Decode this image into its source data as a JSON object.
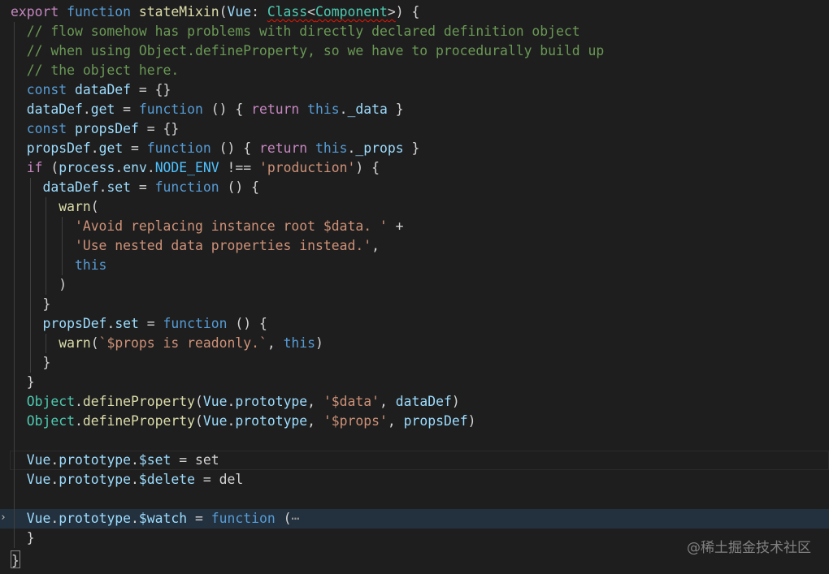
{
  "colors": {
    "keyword": "#c586c0",
    "storage": "#569cd6",
    "function": "#dcdcaa",
    "variable": "#9cdcfe",
    "type": "#4ec9b0",
    "string": "#ce9178",
    "comment": "#6a9955",
    "plain": "#d4d4d4",
    "constant": "#4fc1ff"
  },
  "lines": [
    {
      "indent": 0,
      "tokens": [
        [
          "export ",
          "keyword"
        ],
        [
          "function ",
          "storage"
        ],
        [
          "stateMixin",
          "function"
        ],
        [
          "(",
          "plain"
        ],
        [
          "Vue",
          "variable"
        ],
        [
          ": ",
          "plain"
        ],
        [
          "Class",
          "type",
          "squiggle"
        ],
        [
          "<",
          "plain",
          "squiggle"
        ],
        [
          "Component",
          "type",
          "squiggle"
        ],
        [
          ">",
          "plain",
          "squiggle"
        ],
        [
          ") {",
          "plain"
        ]
      ]
    },
    {
      "indent": 1,
      "tokens": [
        [
          "// flow somehow has problems with directly declared definition object",
          "comment"
        ]
      ]
    },
    {
      "indent": 1,
      "tokens": [
        [
          "// when using Object.defineProperty, so we have to procedurally build up",
          "comment"
        ]
      ]
    },
    {
      "indent": 1,
      "tokens": [
        [
          "// the object here.",
          "comment"
        ]
      ]
    },
    {
      "indent": 1,
      "tokens": [
        [
          "const ",
          "storage"
        ],
        [
          "dataDef",
          "variable"
        ],
        [
          " = {}",
          "plain"
        ]
      ]
    },
    {
      "indent": 1,
      "tokens": [
        [
          "dataDef",
          "variable"
        ],
        [
          ".",
          "plain"
        ],
        [
          "get",
          "variable"
        ],
        [
          " = ",
          "plain"
        ],
        [
          "function",
          "storage"
        ],
        [
          " () { ",
          "plain"
        ],
        [
          "return ",
          "keyword"
        ],
        [
          "this",
          "storage"
        ],
        [
          ".",
          "plain"
        ],
        [
          "_data",
          "variable"
        ],
        [
          " }",
          "plain"
        ]
      ]
    },
    {
      "indent": 1,
      "tokens": [
        [
          "const ",
          "storage"
        ],
        [
          "propsDef",
          "variable"
        ],
        [
          " = {}",
          "plain"
        ]
      ]
    },
    {
      "indent": 1,
      "tokens": [
        [
          "propsDef",
          "variable"
        ],
        [
          ".",
          "plain"
        ],
        [
          "get",
          "variable"
        ],
        [
          " = ",
          "plain"
        ],
        [
          "function",
          "storage"
        ],
        [
          " () { ",
          "plain"
        ],
        [
          "return ",
          "keyword"
        ],
        [
          "this",
          "storage"
        ],
        [
          ".",
          "plain"
        ],
        [
          "_props",
          "variable"
        ],
        [
          " }",
          "plain"
        ]
      ]
    },
    {
      "indent": 1,
      "tokens": [
        [
          "if",
          "keyword"
        ],
        [
          " (",
          "plain"
        ],
        [
          "process",
          "variable"
        ],
        [
          ".",
          "plain"
        ],
        [
          "env",
          "variable"
        ],
        [
          ".",
          "plain"
        ],
        [
          "NODE_ENV",
          "constant"
        ],
        [
          " !== ",
          "plain"
        ],
        [
          "'production'",
          "string"
        ],
        [
          ") {",
          "plain"
        ]
      ]
    },
    {
      "indent": 2,
      "tokens": [
        [
          "dataDef",
          "variable"
        ],
        [
          ".",
          "plain"
        ],
        [
          "set",
          "variable"
        ],
        [
          " = ",
          "plain"
        ],
        [
          "function",
          "storage"
        ],
        [
          " () {",
          "plain"
        ]
      ]
    },
    {
      "indent": 3,
      "tokens": [
        [
          "warn",
          "function"
        ],
        [
          "(",
          "plain"
        ]
      ]
    },
    {
      "indent": 4,
      "tokens": [
        [
          "'Avoid replacing instance root $data. '",
          "string"
        ],
        [
          " +",
          "plain"
        ]
      ]
    },
    {
      "indent": 4,
      "tokens": [
        [
          "'Use nested data properties instead.'",
          "string"
        ],
        [
          ",",
          "plain"
        ]
      ]
    },
    {
      "indent": 4,
      "tokens": [
        [
          "this",
          "storage"
        ]
      ]
    },
    {
      "indent": 3,
      "tokens": [
        [
          ")",
          "plain"
        ]
      ]
    },
    {
      "indent": 2,
      "tokens": [
        [
          "}",
          "plain"
        ]
      ]
    },
    {
      "indent": 2,
      "tokens": [
        [
          "propsDef",
          "variable"
        ],
        [
          ".",
          "plain"
        ],
        [
          "set",
          "variable"
        ],
        [
          " = ",
          "plain"
        ],
        [
          "function",
          "storage"
        ],
        [
          " () {",
          "plain"
        ]
      ]
    },
    {
      "indent": 3,
      "tokens": [
        [
          "warn",
          "function"
        ],
        [
          "(",
          "plain"
        ],
        [
          "`$props is readonly.`",
          "string"
        ],
        [
          ", ",
          "plain"
        ],
        [
          "this",
          "storage"
        ],
        [
          ")",
          "plain"
        ]
      ]
    },
    {
      "indent": 2,
      "tokens": [
        [
          "}",
          "plain"
        ]
      ]
    },
    {
      "indent": 1,
      "tokens": [
        [
          "}",
          "plain"
        ]
      ]
    },
    {
      "indent": 1,
      "tokens": [
        [
          "Object",
          "type"
        ],
        [
          ".",
          "plain"
        ],
        [
          "defineProperty",
          "function"
        ],
        [
          "(",
          "plain"
        ],
        [
          "Vue",
          "variable"
        ],
        [
          ".",
          "plain"
        ],
        [
          "prototype",
          "variable"
        ],
        [
          ", ",
          "plain"
        ],
        [
          "'$data'",
          "string"
        ],
        [
          ", ",
          "plain"
        ],
        [
          "dataDef",
          "variable"
        ],
        [
          ")",
          "plain"
        ]
      ]
    },
    {
      "indent": 1,
      "tokens": [
        [
          "Object",
          "type"
        ],
        [
          ".",
          "plain"
        ],
        [
          "defineProperty",
          "function"
        ],
        [
          "(",
          "plain"
        ],
        [
          "Vue",
          "variable"
        ],
        [
          ".",
          "plain"
        ],
        [
          "prototype",
          "variable"
        ],
        [
          ", ",
          "plain"
        ],
        [
          "'$props'",
          "string"
        ],
        [
          ", ",
          "plain"
        ],
        [
          "propsDef",
          "variable"
        ],
        [
          ")",
          "plain"
        ]
      ]
    },
    {
      "indent": 0,
      "guides": 1,
      "tokens": []
    },
    {
      "indent": 1,
      "current": true,
      "tokens": [
        [
          "Vue",
          "variable"
        ],
        [
          ".",
          "plain"
        ],
        [
          "prototype",
          "variable"
        ],
        [
          ".",
          "plain"
        ],
        [
          "$set",
          "variable"
        ],
        [
          " = ",
          "plain"
        ],
        [
          "set",
          "plain"
        ]
      ]
    },
    {
      "indent": 1,
      "tokens": [
        [
          "Vue",
          "variable"
        ],
        [
          ".",
          "plain"
        ],
        [
          "prototype",
          "variable"
        ],
        [
          ".",
          "plain"
        ],
        [
          "$delete",
          "variable"
        ],
        [
          " = ",
          "plain"
        ],
        [
          "del",
          "plain"
        ]
      ]
    },
    {
      "indent": 0,
      "guides": 1,
      "tokens": []
    },
    {
      "indent": 1,
      "folded": true,
      "tokens": [
        [
          "Vue",
          "variable"
        ],
        [
          ".",
          "plain"
        ],
        [
          "prototype",
          "variable"
        ],
        [
          ".",
          "plain"
        ],
        [
          "$watch",
          "variable"
        ],
        [
          " = ",
          "plain"
        ],
        [
          "function",
          "storage"
        ],
        [
          " (",
          "plain"
        ],
        [
          "⋯",
          "ellipsis"
        ]
      ]
    },
    {
      "indent": 1,
      "tokens": [
        [
          "}",
          "plain"
        ]
      ]
    },
    {
      "indent": 0,
      "tokens": [
        [
          "}",
          "cursor"
        ]
      ]
    }
  ],
  "watermark": "@稀土掘金技术社区"
}
